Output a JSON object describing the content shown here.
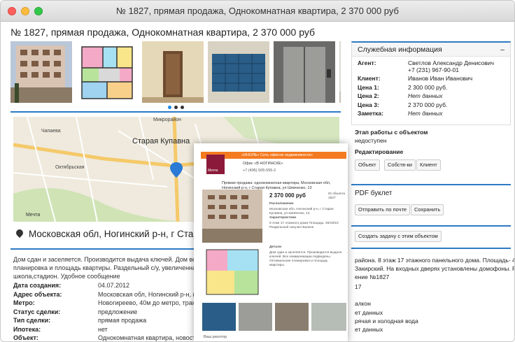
{
  "window": {
    "title": "№ 1827, прямая продажа, Однокомнатная квартира, 2 370 000 руб"
  },
  "page": {
    "heading": "№ 1827, прямая продажа, Однокомнатная квартира, 2 370 000 руб"
  },
  "map": {
    "labels": {
      "top": "Микрорайон",
      "town": "Старая Купавна",
      "left": "Чапаева",
      "mid": "Мечта",
      "road": "Октябрьская"
    },
    "footer": "Мечта"
  },
  "address": "Московская обл, Ногинский р-н, г Старая К",
  "description": "Дом сдан и заселяется. Производится выдача ключей. Дом все коммуникации подведены. кв.м. Оптимальная планировка и площадь квартиры. Раздельный с/у, увеличенная кухня. инфраструктура: магазины, детский сад, школа,стадион. Удобное сообщение",
  "props": [
    {
      "k": "Дата создания:",
      "v": "04.07.2012"
    },
    {
      "k": "Адрес объекта:",
      "v": "Московская обл, Ногинский р-н, г Старая"
    },
    {
      "k": "Метро:",
      "v": "Новогиреево, 40м до метро, транспортом"
    },
    {
      "k": "Статус сделки:",
      "v": "предложение"
    },
    {
      "k": "Тип сделки:",
      "v": "прямая продажа"
    },
    {
      "k": "Ипотека:",
      "v": "нет"
    },
    {
      "k": "Объект:",
      "v": "Однокомнатная квартира, новостройка"
    }
  ],
  "side": {
    "title": "Служебная информация",
    "toggle": "–",
    "rows": [
      {
        "k": "Агент:",
        "v": "Светлов Александр Денисович"
      },
      {
        "k": "",
        "v": "+7 (231) 967-90-01"
      },
      {
        "k": "Клиент:",
        "v": "Иванов Иван Иванович"
      },
      {
        "k": "Цена 1:",
        "v": "2 300 000 руб."
      },
      {
        "k": "Цена 2:",
        "v": "Нет данных"
      },
      {
        "k": "Цена 3:",
        "v": "2 370 000 руб."
      },
      {
        "k": "Заметка:",
        "v": "Нет данных"
      }
    ],
    "stage_label": "Этап работы с объектом",
    "stage_value": "недоступен",
    "edit_label": "Редактирование",
    "edit_buttons": [
      "Объект",
      "Собств-ки",
      "Клиент"
    ],
    "pdf_label": "PDF буклет",
    "pdf_buttons": [
      "Отправить по почте",
      "Сохранить"
    ],
    "task_button": "Создать задачу с этим объектом",
    "extra": [
      "района. 8 этаж 17 этажного панельного дома. Площадь- 46/19/10",
      "Закирский. На входных дверях установлены домофоны. Развитая",
      "ение №1827",
      "17",
      "алкон",
      "ет данных",
      "рячая и холодная вода",
      "ет данных"
    ]
  },
  "overlay": {
    "banner": "«ИНОЛЬ» Сеть офисов недвижимости»",
    "office": "Офис «В НОГИНСКЕ»",
    "phone": "+7 (495) 505-555-2",
    "brand": "Мечта",
    "sale": "Прямая продажа: однокомнатная квартира, Московская обл, Ногинский р-н, г Старая Купавна, ул Шевченко, 13",
    "price": "2 370 000 руб",
    "obj": "ID объекта 1827",
    "loc_h": "Расположение",
    "loc": "Московская обл, Ногинский р-н, г Старая Купавна, ул Шевченко, 13",
    "char_h": "Характеристики",
    "char": "8 этаж 17 этажного дома Площадь: 46/19/10 Раздельный санузел Балкон",
    "det_h": "Детали",
    "det": "Дом сдан и заселяется. Производится выдача ключей. Все коммуникации подведены. Оптимальная планировка и площадь квартиры.",
    "agent": "Ваш риэлтор"
  }
}
